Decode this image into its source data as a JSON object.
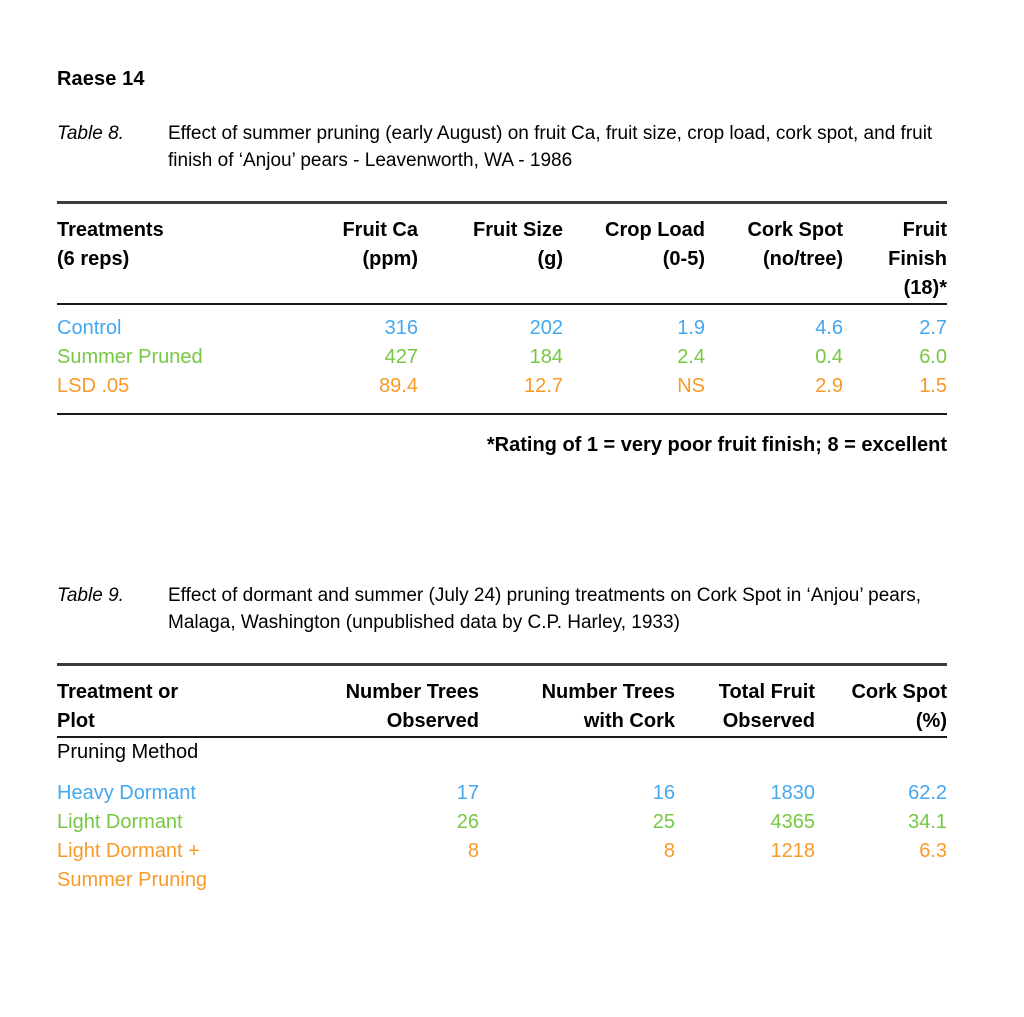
{
  "document": {
    "running_head": "Raese 14"
  },
  "colors": {
    "row_1": "#44a8f0",
    "row_2": "#76c843",
    "row_3": "#f89a28",
    "rule": "#3b3b3b",
    "text": "#000000"
  },
  "table8": {
    "label": "Table 8.",
    "caption": "Effect of summer pruning (early August) on fruit Ca, fruit size, crop load, cork spot, and fruit finish of ‘Anjou’ pears - Leavenworth, WA - 1986",
    "headers": [
      "Treatments\n(6 reps)",
      "Fruit Ca\n(ppm)",
      "Fruit Size\n(g)",
      "Crop Load\n(0-5)",
      "Cork Spot\n(no/tree)",
      "Fruit Finish\n(18)*"
    ],
    "rows": [
      {
        "treatment": "Control",
        "fruit_ca": "316",
        "fruit_size": "202",
        "crop_load": "1.9",
        "cork_spot": "4.6",
        "fruit_finish": "2.7"
      },
      {
        "treatment": "Summer Pruned",
        "fruit_ca": "427",
        "fruit_size": "184",
        "crop_load": "2.4",
        "cork_spot": "0.4",
        "fruit_finish": "6.0"
      },
      {
        "treatment": "LSD .05",
        "fruit_ca": "89.4",
        "fruit_size": "12.7",
        "crop_load": "NS",
        "cork_spot": "2.9",
        "fruit_finish": "1.5"
      }
    ],
    "footnote": "*Rating of 1 = very poor fruit finish; 8 = excellent"
  },
  "table9": {
    "label": "Table 9.",
    "caption": "Effect of dormant and summer (July 24) pruning treatments on Cork Spot in ‘Anjou’ pears, Malaga, Washington (unpublished data by C.P. Harley, 1933)",
    "headers": [
      "Treatment or\nPlot",
      "Number Trees\nObserved",
      "Number Trees\nwith Cork",
      "Total Fruit\nObserved",
      "Cork Spot\n(%)"
    ],
    "section_heading": "Pruning Method",
    "rows": [
      {
        "treatment": "Heavy Dormant",
        "trees_observed": "17",
        "trees_with_cork": "16",
        "total_fruit": "1830",
        "cork_spot_pct": "62.2"
      },
      {
        "treatment": "Light Dormant",
        "trees_observed": "26",
        "trees_with_cork": "25",
        "total_fruit": "4365",
        "cork_spot_pct": "34.1"
      },
      {
        "treatment": "Light Dormant +\nSummer Pruning",
        "trees_observed": "8",
        "trees_with_cork": "8",
        "total_fruit": "1218",
        "cork_spot_pct": "6.3"
      }
    ]
  }
}
